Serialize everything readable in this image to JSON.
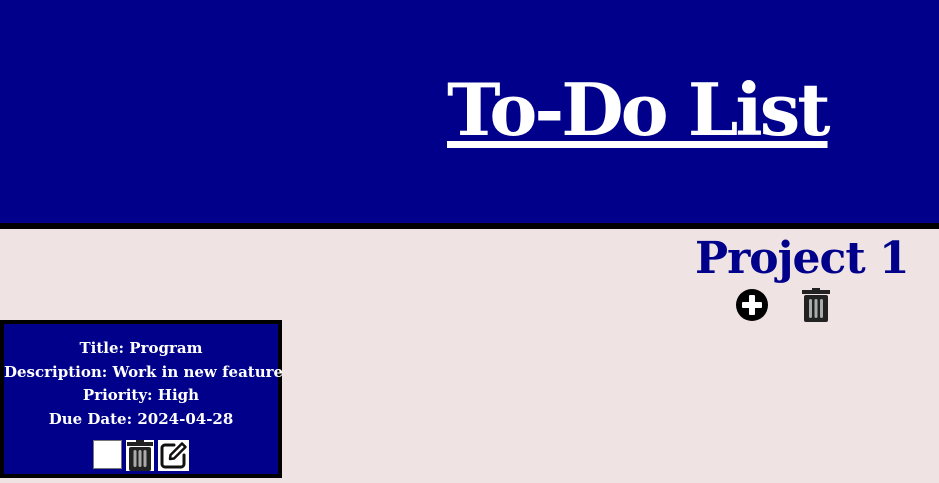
{
  "header": {
    "title": "To-Do List"
  },
  "project": {
    "name": "Project 1",
    "icons": {
      "add": "plus-circle-icon",
      "delete": "trash-icon"
    }
  },
  "tasks": [
    {
      "title_label": "Title: Program",
      "description_label": "Description: Work in new feature",
      "priority_label": "Priority: High",
      "due_label": "Due Date: 2024-04-28",
      "completed": false,
      "icons": {
        "delete": "trash-icon",
        "edit": "edit-icon"
      }
    }
  ],
  "colors": {
    "header_bg": "#00008b",
    "page_bg": "#efe3e3",
    "card_bg": "#00008b",
    "accent_text": "#00008b"
  }
}
